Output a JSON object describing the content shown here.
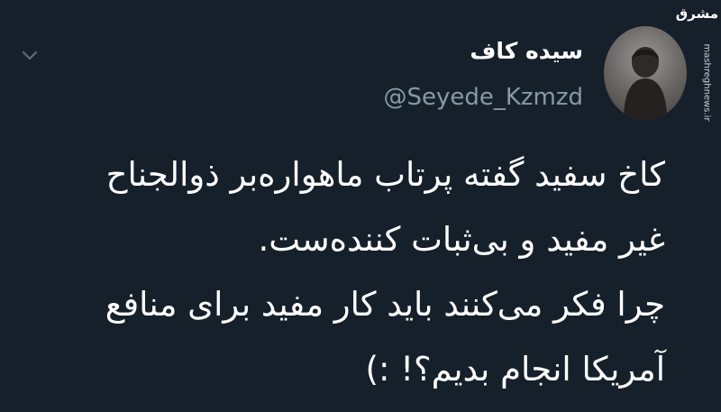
{
  "tweet": {
    "display_name": "سیده کاف",
    "handle": "@Seyede_Kzmzd",
    "lines": [
      "کاخ سفید گفته پرتاب ماهواره‌بر ذوالجناح",
      "غیر مفید و بی‌ثبات کننده‌ست.",
      "چرا فکر می‌کنند باید کار مفید برای منافع",
      "آمریکا انجام بدیم؟! :)"
    ]
  },
  "watermark": {
    "logo_text": "مشرق",
    "site": "mashreghnews.ir"
  },
  "icons": {
    "avatar": "profile-photo",
    "chevron": "chevron-down-icon"
  },
  "colors": {
    "background": "#16202b",
    "text": "#ffffff",
    "secondary": "#8899a6"
  }
}
